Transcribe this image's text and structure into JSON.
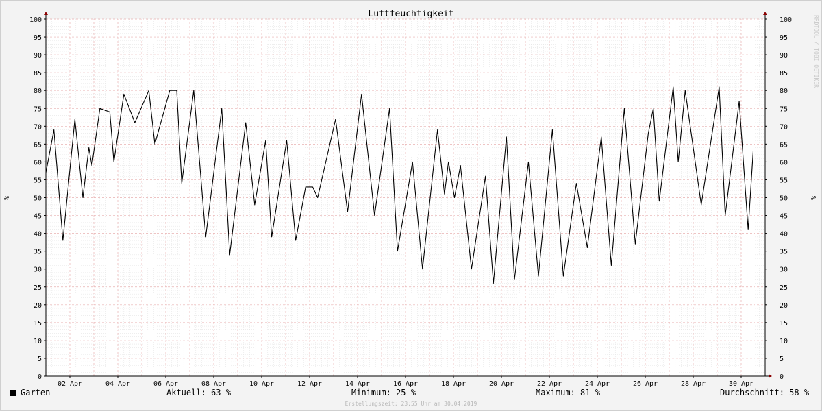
{
  "chart_data": {
    "type": "line",
    "title": "Luftfeuchtigkeit",
    "ylabel": "%",
    "ylabel_right": "%",
    "watermark": "RRDTOOL / TOBI OETIKER",
    "ylim": [
      0,
      100
    ],
    "xlim": [
      "2019-04-01T00:00",
      "2019-05-01T00:00"
    ],
    "y_ticks": [
      "0",
      "5",
      "10",
      "15",
      "20",
      "25",
      "30",
      "35",
      "40",
      "45",
      "50",
      "55",
      "60",
      "65",
      "70",
      "75",
      "80",
      "85",
      "90",
      "95",
      "100"
    ],
    "x_ticks": [
      {
        "date": "2019-04-02",
        "label": "02 Apr"
      },
      {
        "date": "2019-04-04",
        "label": "04 Apr"
      },
      {
        "date": "2019-04-06",
        "label": "06 Apr"
      },
      {
        "date": "2019-04-08",
        "label": "08 Apr"
      },
      {
        "date": "2019-04-10",
        "label": "10 Apr"
      },
      {
        "date": "2019-04-12",
        "label": "12 Apr"
      },
      {
        "date": "2019-04-14",
        "label": "14 Apr"
      },
      {
        "date": "2019-04-16",
        "label": "16 Apr"
      },
      {
        "date": "2019-04-18",
        "label": "18 Apr"
      },
      {
        "date": "2019-04-20",
        "label": "20 Apr"
      },
      {
        "date": "2019-04-22",
        "label": "22 Apr"
      },
      {
        "date": "2019-04-24",
        "label": "24 Apr"
      },
      {
        "date": "2019-04-26",
        "label": "26 Apr"
      },
      {
        "date": "2019-04-28",
        "label": "28 Apr"
      },
      {
        "date": "2019-04-30",
        "label": "30 Apr"
      }
    ],
    "grid": true,
    "series": [
      {
        "name": "Garten",
        "color": "#000000",
        "points": [
          [
            "2019-04-01T00:00",
            57
          ],
          [
            "2019-04-01T08:00",
            69
          ],
          [
            "2019-04-01T17:00",
            38
          ],
          [
            "2019-04-02T05:00",
            72
          ],
          [
            "2019-04-02T13:00",
            50
          ],
          [
            "2019-04-02T19:00",
            64
          ],
          [
            "2019-04-02T22:00",
            59
          ],
          [
            "2019-04-03T06:00",
            75
          ],
          [
            "2019-04-03T16:00",
            74
          ],
          [
            "2019-04-03T20:00",
            60
          ],
          [
            "2019-04-04T06:00",
            79
          ],
          [
            "2019-04-04T17:00",
            71
          ],
          [
            "2019-04-05T07:00",
            80
          ],
          [
            "2019-04-05T13:00",
            65
          ],
          [
            "2019-04-06T04:00",
            80
          ],
          [
            "2019-04-06T11:00",
            80
          ],
          [
            "2019-04-06T16:00",
            54
          ],
          [
            "2019-04-07T04:00",
            80
          ],
          [
            "2019-04-07T16:00",
            39
          ],
          [
            "2019-04-08T08:00",
            75
          ],
          [
            "2019-04-08T16:00",
            34
          ],
          [
            "2019-04-09T08:00",
            71
          ],
          [
            "2019-04-09T17:00",
            48
          ],
          [
            "2019-04-10T04:00",
            66
          ],
          [
            "2019-04-10T10:00",
            39
          ],
          [
            "2019-04-11T01:00",
            66
          ],
          [
            "2019-04-11T10:00",
            38
          ],
          [
            "2019-04-11T20:00",
            53
          ],
          [
            "2019-04-12T03:00",
            53
          ],
          [
            "2019-04-12T08:00",
            50
          ],
          [
            "2019-04-13T02:00",
            72
          ],
          [
            "2019-04-13T14:00",
            46
          ],
          [
            "2019-04-14T04:00",
            79
          ],
          [
            "2019-04-14T17:00",
            45
          ],
          [
            "2019-04-15T08:00",
            75
          ],
          [
            "2019-04-15T16:00",
            35
          ],
          [
            "2019-04-16T07:00",
            60
          ],
          [
            "2019-04-16T17:00",
            30
          ],
          [
            "2019-04-17T08:00",
            69
          ],
          [
            "2019-04-17T15:00",
            51
          ],
          [
            "2019-04-17T19:00",
            60
          ],
          [
            "2019-04-18T01:00",
            50
          ],
          [
            "2019-04-18T07:00",
            59
          ],
          [
            "2019-04-18T18:00",
            30
          ],
          [
            "2019-04-19T08:00",
            56
          ],
          [
            "2019-04-19T16:00",
            26
          ],
          [
            "2019-04-20T05:00",
            67
          ],
          [
            "2019-04-20T13:00",
            27
          ],
          [
            "2019-04-21T03:00",
            60
          ],
          [
            "2019-04-21T13:00",
            28
          ],
          [
            "2019-04-22T03:00",
            69
          ],
          [
            "2019-04-22T14:00",
            28
          ],
          [
            "2019-04-23T03:00",
            54
          ],
          [
            "2019-04-23T14:00",
            36
          ],
          [
            "2019-04-24T04:00",
            67
          ],
          [
            "2019-04-24T14:00",
            31
          ],
          [
            "2019-04-25T03:00",
            75
          ],
          [
            "2019-04-25T14:00",
            37
          ],
          [
            "2019-04-26T03:00",
            68
          ],
          [
            "2019-04-26T08:00",
            75
          ],
          [
            "2019-04-26T14:00",
            49
          ],
          [
            "2019-04-27T04:00",
            81
          ],
          [
            "2019-04-27T09:00",
            60
          ],
          [
            "2019-04-27T16:00",
            80
          ],
          [
            "2019-04-28T08:00",
            48
          ],
          [
            "2019-04-29T02:00",
            81
          ],
          [
            "2019-04-29T08:00",
            45
          ],
          [
            "2019-04-29T22:00",
            77
          ],
          [
            "2019-04-30T07:00",
            41
          ],
          [
            "2019-04-30T12:00",
            63
          ]
        ]
      }
    ]
  },
  "legend": {
    "series_label": "Garten"
  },
  "stats": {
    "current": {
      "label": "Aktuell:",
      "value": "63 %"
    },
    "minimum": {
      "label": "Minimum:",
      "value": "25 %"
    },
    "maximum": {
      "label": "Maximum:",
      "value": "81 %"
    },
    "average": {
      "label": "Durchschnitt:",
      "value": "58 %"
    }
  },
  "footer": {
    "created": "Erstellungszeit: 23:55 Uhr am 30.04.2019"
  }
}
